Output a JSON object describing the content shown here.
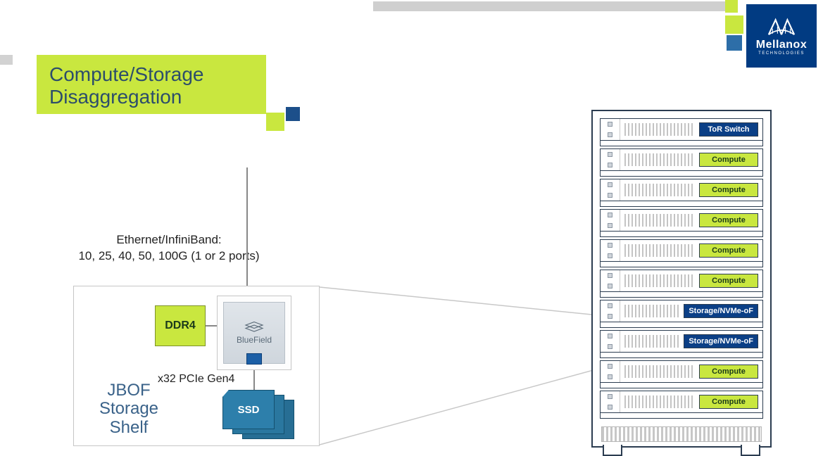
{
  "brand": {
    "name": "Mellanox",
    "sub": "TECHNOLOGIES"
  },
  "title": {
    "line1": "Compute/Storage",
    "line2": "Disaggregation"
  },
  "connection": {
    "line1": "Ethernet/InfiniBand:",
    "line2": "10, 25, 40, 50, 100G (1 or 2 ports)"
  },
  "shelf": {
    "label_l1": "JBOF",
    "label_l2": "Storage",
    "label_l3": "Shelf",
    "ddr4": "DDR4",
    "chip": "BlueField",
    "pcie": "x32 PCIe Gen4",
    "ssd": "SSD"
  },
  "rack": {
    "slots": [
      {
        "kind": "blue",
        "label": "ToR Switch"
      },
      {
        "kind": "green",
        "label": "Compute"
      },
      {
        "kind": "green",
        "label": "Compute"
      },
      {
        "kind": "green",
        "label": "Compute"
      },
      {
        "kind": "green",
        "label": "Compute"
      },
      {
        "kind": "green",
        "label": "Compute"
      },
      {
        "kind": "blue",
        "label": "Storage/NVMe-oF"
      },
      {
        "kind": "blue",
        "label": "Storage/NVMe-oF"
      },
      {
        "kind": "green",
        "label": "Compute"
      },
      {
        "kind": "green",
        "label": "Compute"
      }
    ]
  }
}
